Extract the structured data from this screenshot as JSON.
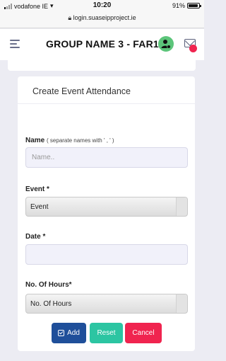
{
  "status_bar": {
    "carrier": "vodafone IE",
    "time": "10:20",
    "battery": "91%",
    "battery_level": 0.91,
    "url": "login.suaseipproject.ie"
  },
  "header": {
    "title": "GROUP NAME 3 -  FAR1",
    "menu_icon": "hamburger-icon",
    "user_icon": "user-settings-icon",
    "mail_icon": "mail-icon"
  },
  "form": {
    "title": "Create Event Attendance",
    "name_label": "Name",
    "name_hint": "( separate names with ' , ' )",
    "name_placeholder": "Name..",
    "event_label": "Event *",
    "event_selected": "Event",
    "date_label": "Date *",
    "hours_label": "No. Of Hours*",
    "hours_selected": "No. Of Hours"
  },
  "buttons": {
    "add": "Add",
    "reset": "Reset",
    "cancel": "Cancel"
  },
  "colors": {
    "add": "#1f4f9a",
    "reset": "#2cc5a2",
    "cancel": "#f0244f",
    "user_icon_bg": "#5cc57a"
  }
}
